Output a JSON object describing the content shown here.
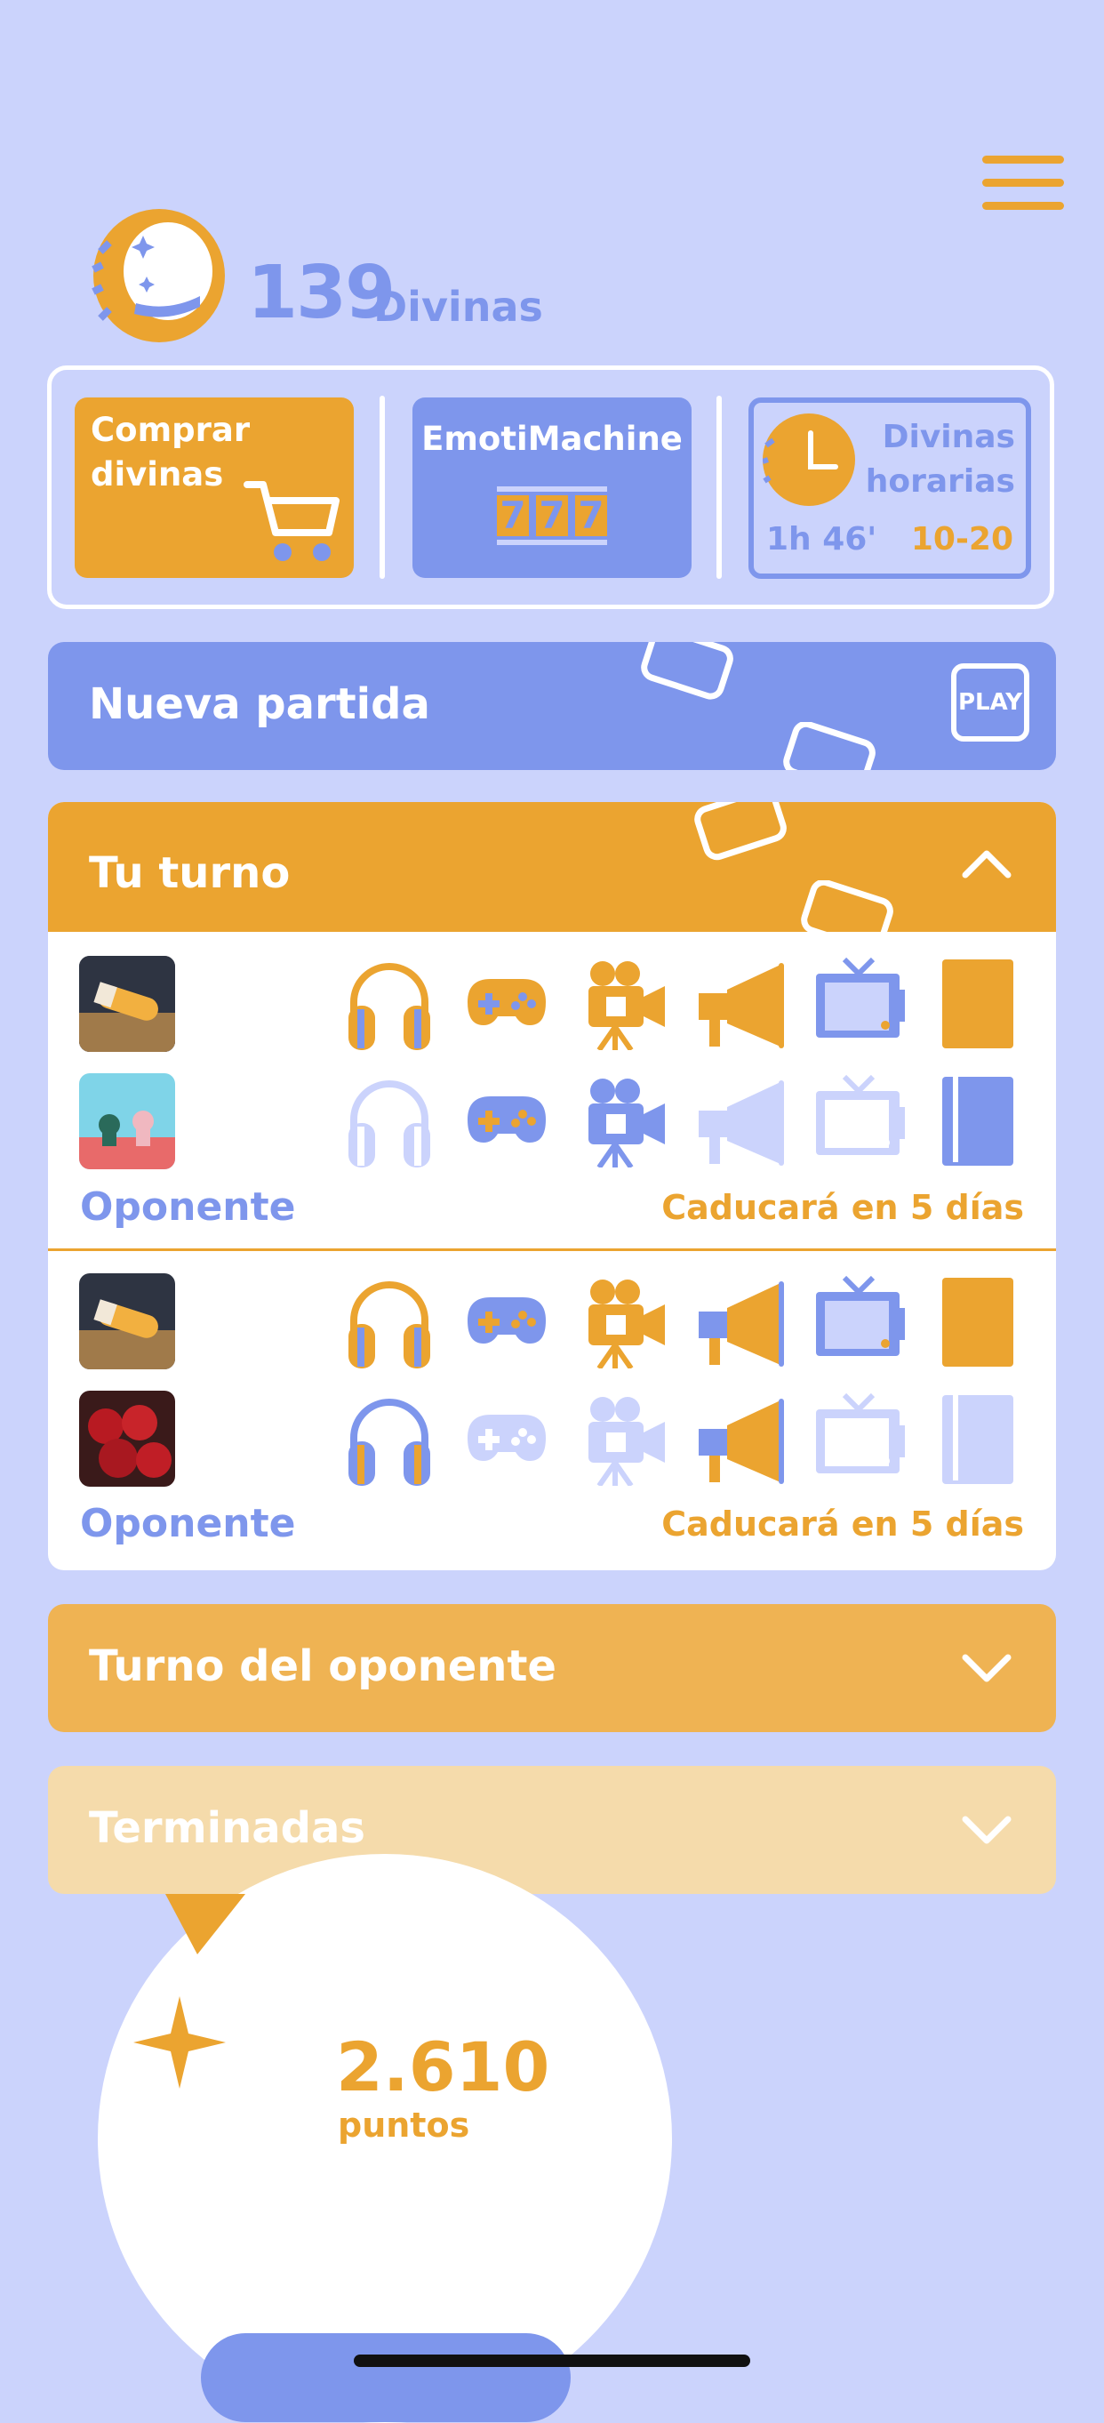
{
  "colors": {
    "orange": "#EBA430",
    "blue": "#7E96EC",
    "lightBlue": "#CBD3FC",
    "paleOrange": "#F5DBAB",
    "midOrange": "#EFB353"
  },
  "header": {
    "menu_icon": "hamburger-icon",
    "coin_icon": "divina-coin-icon",
    "count": "139",
    "count_label": "Divinas"
  },
  "cards": {
    "buy": {
      "line1": "Comprar",
      "line2": "divinas",
      "icon": "cart-icon"
    },
    "emoti": {
      "title": "EmotiMachine",
      "reels": [
        "7",
        "7",
        "7"
      ]
    },
    "hourly": {
      "line1": "Divinas",
      "line2": "horarias",
      "timer": "1h 46'",
      "range": "10-20",
      "icon": "clock-icon"
    }
  },
  "new_game": {
    "label": "Nueva partida",
    "play": "PLAY"
  },
  "your_turn": {
    "title": "Tu turno",
    "games": [
      {
        "avatar1": "bottle-photo",
        "avatar2": "chess-photo",
        "row1": [
          "orange",
          "orange",
          "orange",
          "orange",
          "blue",
          "orange"
        ],
        "row2": [
          "faded",
          "blue",
          "blue",
          "faded",
          "faded",
          "blue"
        ],
        "opponent": "Oponente",
        "expires": "Caducará en 5 días"
      },
      {
        "avatar1": "bottle-photo",
        "avatar2": "cherries-photo",
        "row1": [
          "orange",
          "blue",
          "orange",
          "mixed",
          "blue",
          "orange"
        ],
        "row2": [
          "blue",
          "faded",
          "faded",
          "mixed",
          "faded",
          "faded"
        ],
        "opponent": "Oponente",
        "expires": "Caducará en 5 días"
      }
    ]
  },
  "opponent_turn": {
    "title": "Turno del oponente"
  },
  "finished": {
    "title": "Terminadas"
  },
  "score": {
    "value": "2.610",
    "label": "puntos"
  }
}
